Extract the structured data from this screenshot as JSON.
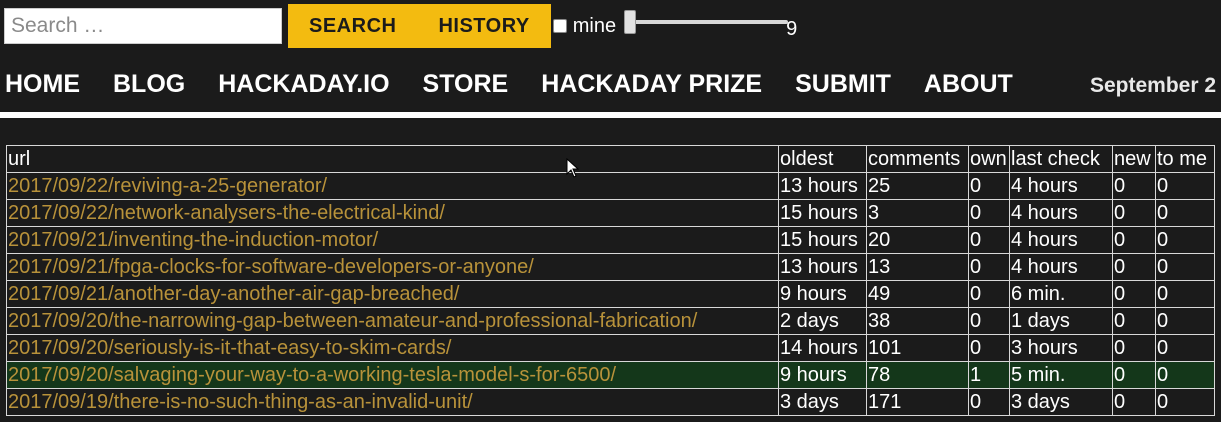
{
  "search": {
    "placeholder": "Search …",
    "value": ""
  },
  "buttons": {
    "search_label": "SEARCH",
    "history_label": "HISTORY"
  },
  "mine": {
    "label": "mine",
    "checked": false
  },
  "slider": {
    "value": "9",
    "position_fraction": 0.0
  },
  "nav": {
    "items": [
      "HOME",
      "BLOG",
      "HACKADAY.IO",
      "STORE",
      "HACKADAY PRIZE",
      "SUBMIT",
      "ABOUT"
    ],
    "date": "September 2"
  },
  "table": {
    "headers": [
      "url",
      "oldest",
      "comments",
      "own",
      "last check",
      "new",
      "to me"
    ],
    "rows": [
      {
        "url": "2017/09/22/reviving-a-25-generator/",
        "oldest": "13 hours",
        "comments": "25",
        "own": "0",
        "last_check": "4 hours",
        "new": "0",
        "to_me": "0",
        "highlight": false
      },
      {
        "url": "2017/09/22/network-analysers-the-electrical-kind/",
        "oldest": "15 hours",
        "comments": "3",
        "own": "0",
        "last_check": "4 hours",
        "new": "0",
        "to_me": "0",
        "highlight": false
      },
      {
        "url": "2017/09/21/inventing-the-induction-motor/",
        "oldest": "15 hours",
        "comments": "20",
        "own": "0",
        "last_check": "4 hours",
        "new": "0",
        "to_me": "0",
        "highlight": false
      },
      {
        "url": "2017/09/21/fpga-clocks-for-software-developers-or-anyone/",
        "oldest": "13 hours",
        "comments": "13",
        "own": "0",
        "last_check": "4 hours",
        "new": "0",
        "to_me": "0",
        "highlight": false
      },
      {
        "url": "2017/09/21/another-day-another-air-gap-breached/",
        "oldest": "9 hours",
        "comments": "49",
        "own": "0",
        "last_check": "6 min.",
        "new": "0",
        "to_me": "0",
        "highlight": false
      },
      {
        "url": "2017/09/20/the-narrowing-gap-between-amateur-and-professional-fabrication/",
        "oldest": "2 days",
        "comments": "38",
        "own": "0",
        "last_check": "1 days",
        "new": "0",
        "to_me": "0",
        "highlight": false
      },
      {
        "url": "2017/09/20/seriously-is-it-that-easy-to-skim-cards/",
        "oldest": "14 hours",
        "comments": "101",
        "own": "0",
        "last_check": "3 hours",
        "new": "0",
        "to_me": "0",
        "highlight": false
      },
      {
        "url": "2017/09/20/salvaging-your-way-to-a-working-tesla-model-s-for-6500/",
        "oldest": "9 hours",
        "comments": "78",
        "own": "1",
        "last_check": "5 min.",
        "new": "0",
        "to_me": "0",
        "highlight": true
      },
      {
        "url": "2017/09/19/there-is-no-such-thing-as-an-invalid-unit/",
        "oldest": "3 days",
        "comments": "171",
        "own": "0",
        "last_check": "3 days",
        "new": "0",
        "to_me": "0",
        "highlight": false
      }
    ]
  },
  "colors": {
    "background": "#1b1b1b",
    "accent": "#f3bb10",
    "link": "#b8923a",
    "highlight_row": "#14371a"
  }
}
